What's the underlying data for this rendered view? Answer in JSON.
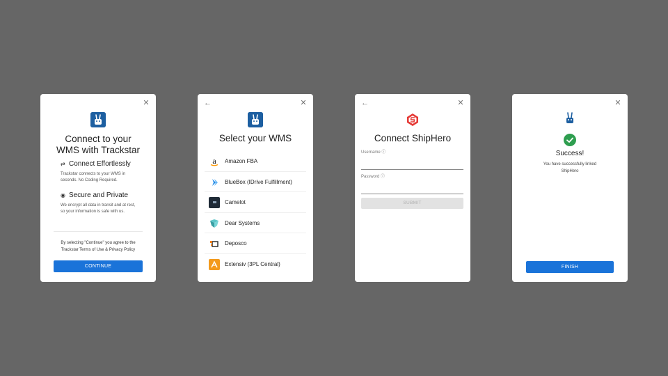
{
  "card1": {
    "title_line1": "Connect to your",
    "title_line2": "WMS with Trackstar",
    "features": [
      {
        "icon": "link-icon",
        "heading": "Connect Effortlessly",
        "text": "Trackstar connects to your WMS in seconds. No Coding Required."
      },
      {
        "icon": "eye-off-icon",
        "heading": "Secure and Private",
        "text": "We encrypt all data in transit and at rest, so your information is safe with us."
      }
    ],
    "terms_line1": "By selecting \"Continue\" you agree to the",
    "terms_line2": "Trackstar Terms of Use & Privacy Policy",
    "button": "CONTINUE"
  },
  "card2": {
    "title": "Select your WMS",
    "items": [
      {
        "label": "Amazon FBA",
        "icon": "amazon-logo-icon"
      },
      {
        "label": "BlueBox (IDrive Fulfillment)",
        "icon": "bluebox-logo-icon"
      },
      {
        "label": "Camelot",
        "icon": "camelot-logo-icon"
      },
      {
        "label": "Dear Systems",
        "icon": "dear-systems-logo-icon"
      },
      {
        "label": "Deposco",
        "icon": "deposco-logo-icon"
      },
      {
        "label": "Extensiv (3PL Central)",
        "icon": "extensiv-logo-icon"
      }
    ]
  },
  "card3": {
    "title": "Connect ShipHero",
    "username_label": "Username ⓘ",
    "password_label": "Password ⓘ",
    "username_value": "",
    "password_value": "",
    "submit": "SUBMIT"
  },
  "card4": {
    "title": "Success!",
    "message_line1": "You have successfully linked",
    "message_line2": "ShipHero",
    "button": "FINISH"
  },
  "colors": {
    "background": "#666666",
    "primary": "#1a73d9",
    "brand": "#1d5fa1",
    "success": "#2e9e4f",
    "shiphero": "#e53935"
  }
}
